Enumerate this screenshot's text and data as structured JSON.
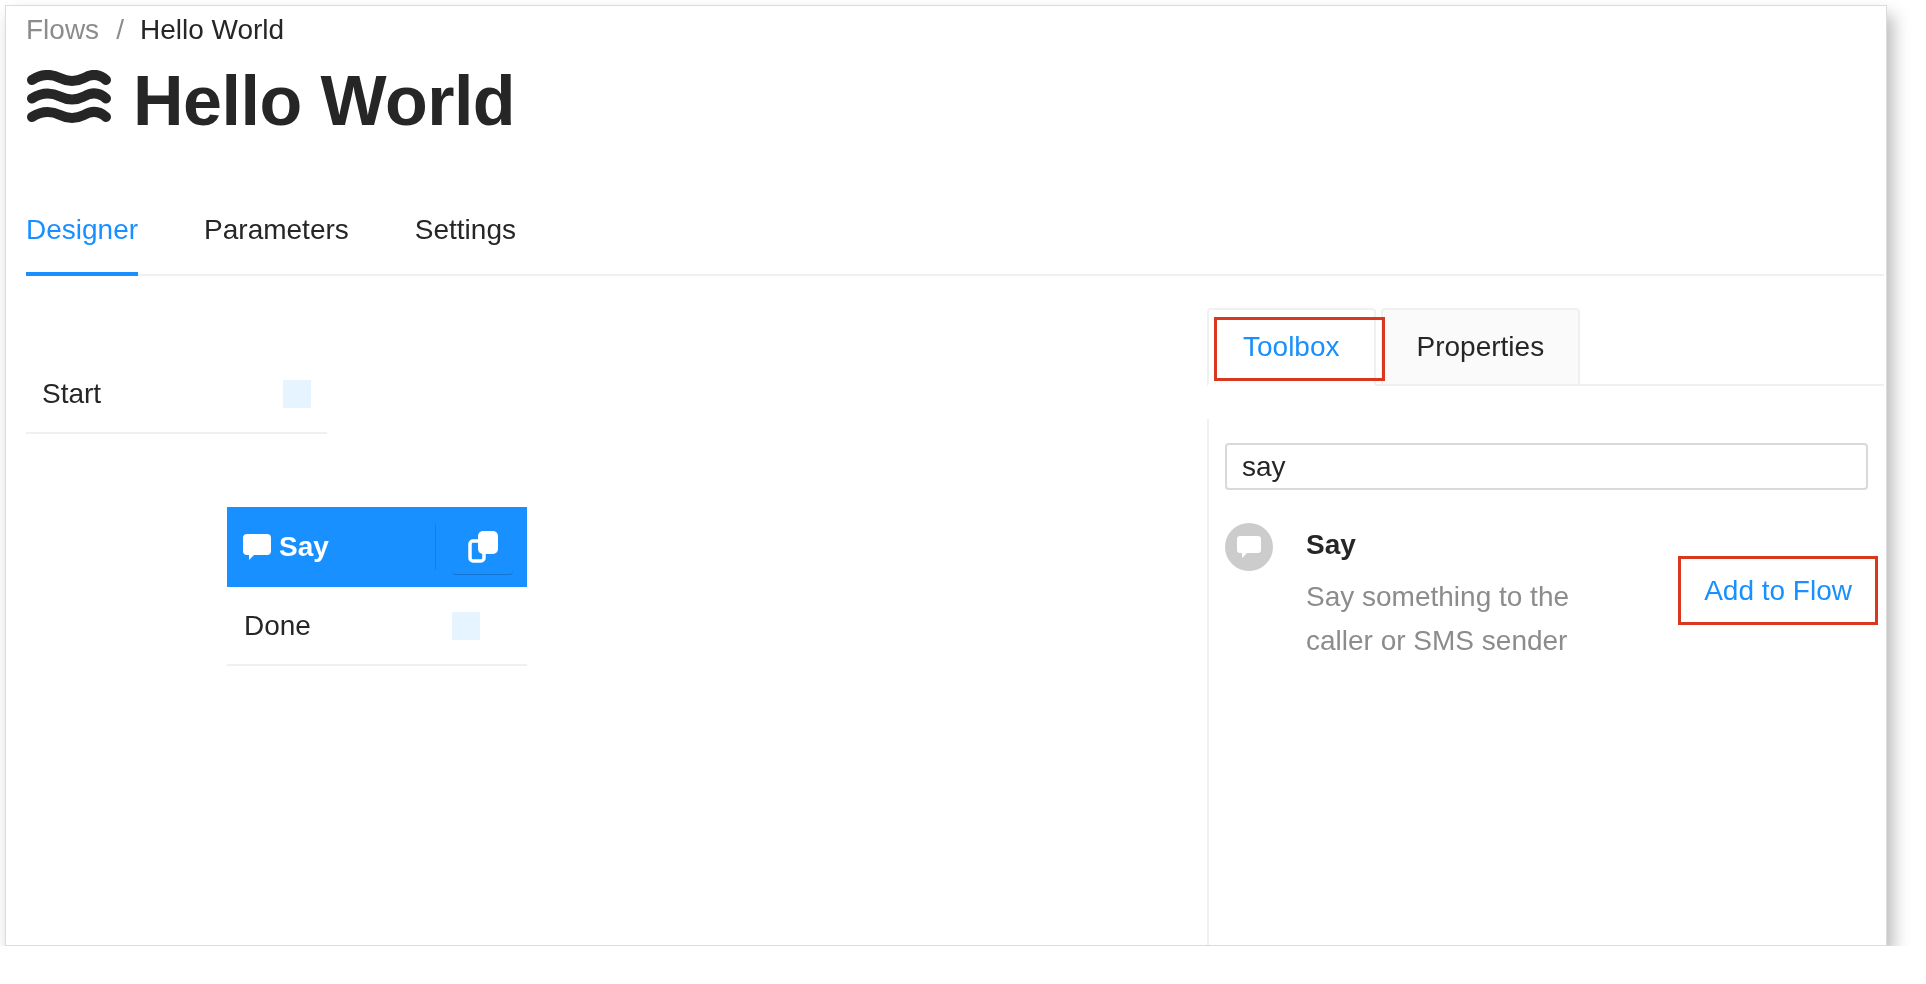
{
  "breadcrumb": {
    "items": [
      {
        "label": "Flows",
        "current": false
      },
      {
        "label": "Hello World",
        "current": true
      }
    ],
    "separator": "/"
  },
  "title": "Hello World",
  "tabs": [
    {
      "label": "Designer",
      "selected": true
    },
    {
      "label": "Parameters",
      "selected": false
    },
    {
      "label": "Settings",
      "selected": false
    }
  ],
  "canvas": {
    "nodes": [
      {
        "kind": "start",
        "label": "Start"
      },
      {
        "kind": "activity",
        "label": "Say",
        "outcomes": [
          {
            "label": "Done"
          }
        ]
      }
    ]
  },
  "side_panel": {
    "tabs": [
      {
        "label": "Toolbox",
        "selected": true,
        "highlighted": true
      },
      {
        "label": "Properties",
        "selected": false,
        "highlighted": false
      }
    ],
    "search": {
      "value": "say"
    },
    "results": [
      {
        "title": "Say",
        "description": "Say something to the caller or SMS sender",
        "action": {
          "label": "Add to Flow",
          "highlighted": true
        }
      }
    ]
  }
}
